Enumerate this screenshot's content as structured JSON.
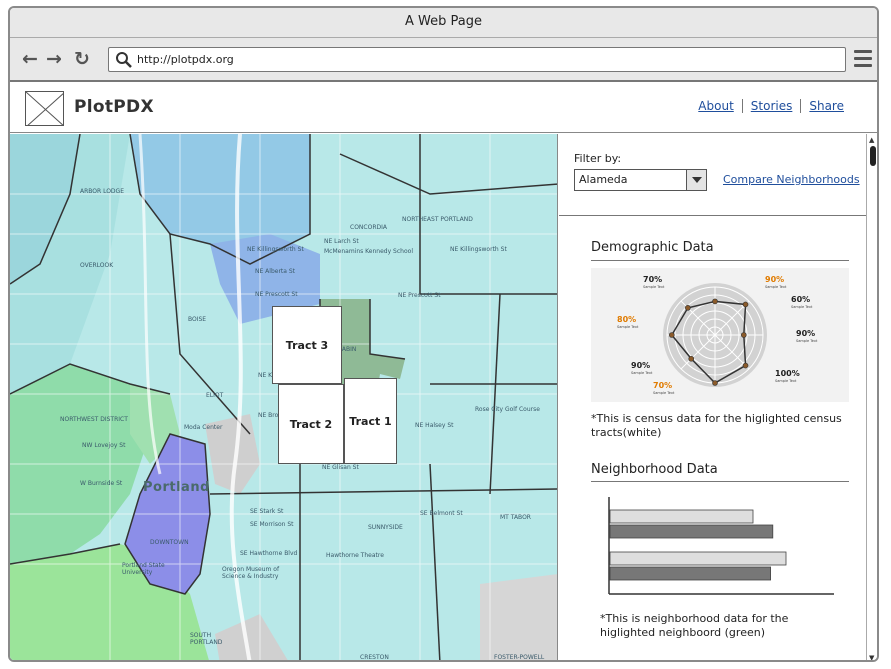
{
  "window": {
    "title": "A Web Page"
  },
  "browser": {
    "url": "http://plotpdx.org"
  },
  "site": {
    "brand": "PlotPDX",
    "nav": [
      {
        "label": "About"
      },
      {
        "label": "Stories"
      },
      {
        "label": "Share"
      }
    ]
  },
  "map": {
    "tracts": [
      {
        "label": "Tract 3"
      },
      {
        "label": "Tract 2"
      },
      {
        "label": "Tract 1"
      }
    ],
    "city_label": "Portland",
    "place_labels": [
      "ARBOR LODGE",
      "OVERLOOK",
      "NE Killingsworth St",
      "NE Alberta St",
      "NE Prescott St",
      "CONCORDIA",
      "NORTHEAST PORTLAND",
      "NE Larch St",
      "McMenamins Kennedy School",
      "NE Prescott St",
      "BOISE",
      "ELIOT",
      "SABIN",
      "NE Knott St",
      "NE Broadway",
      "Rose City Golf Course",
      "NE Halsey St",
      "NORTHWEST DISTRICT",
      "NW Lovejoy St",
      "Moda Center",
      "NE Glisan St",
      "SE Stark St",
      "SE Morrison St",
      "SE Belmont St",
      "SUNNYSIDE",
      "SE Hawthorne Blvd",
      "Hawthorne Theatre",
      "Oregon Museum of Science & Industry",
      "Portland State University",
      "DOWNTOWN",
      "SOUTH PORTLAND",
      "CRESTON",
      "FOSTER-POWELL",
      "MT TABOR",
      "NE Killingsworth St",
      "W Burnside St"
    ]
  },
  "sidebar": {
    "filter_label": "Filter by:",
    "filter_value": "Alameda",
    "compare_label": "Compare Neighborhoods",
    "demographic_title": "Demographic Data",
    "demographic_note": "*This is census data for the higlighted census tracts(white)",
    "radar_labels": [
      {
        "value": "70%",
        "sub": "Sample Text"
      },
      {
        "value": "90%",
        "sub": "Sample Text"
      },
      {
        "value": "60%",
        "sub": "Sample Text"
      },
      {
        "value": "80%",
        "sub": "Sample Text"
      },
      {
        "value": "90%",
        "sub": "Sample Text"
      },
      {
        "value": "90%",
        "sub": "Sample Text"
      },
      {
        "value": "70%",
        "sub": "Sample Text"
      },
      {
        "value": "100%",
        "sub": "Sample Text"
      }
    ],
    "neighborhood_title": "Neighborhood Data",
    "neighborhood_note": "*This is neighborhood data for the higlighted neighboord (green)"
  },
  "chart_data": [
    {
      "type": "radar",
      "axes": 8,
      "values": [
        70,
        90,
        60,
        90,
        100,
        70,
        90,
        80
      ]
    },
    {
      "type": "bar",
      "orientation": "horizontal",
      "series": [
        {
          "values": [
            0.65,
            0.8
          ],
          "color": "#dedede"
        },
        {
          "values": [
            0.74,
            0.73
          ],
          "color": "#777777"
        }
      ]
    }
  ]
}
